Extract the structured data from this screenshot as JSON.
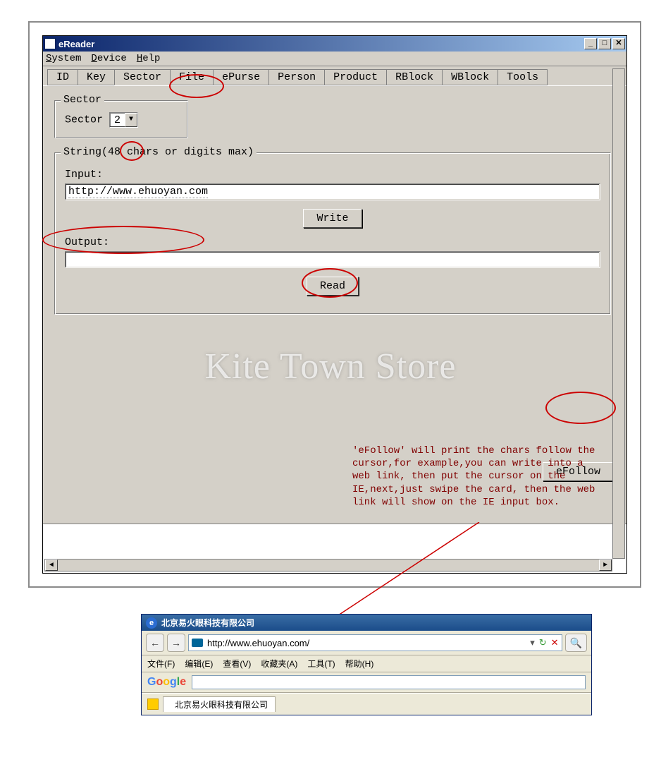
{
  "watermark": "Kite Town Store",
  "window": {
    "title": "eReader",
    "menus": {
      "system": "System",
      "device": "Device",
      "help": "Help"
    },
    "tabs": [
      "ID",
      "Key",
      "Sector",
      "File",
      "ePurse",
      "Person",
      "Product",
      "RBlock",
      "WBlock",
      "Tools"
    ],
    "active_tab_index": 2
  },
  "sector": {
    "legend": "Sector",
    "label": "Sector",
    "value": "2"
  },
  "string_group": {
    "legend": "String(48 chars or digits max)",
    "input_label": "Input:",
    "input_value": "http://www.ehuoyan.com",
    "write_btn": "Write",
    "output_label": "Output:",
    "output_value": "",
    "read_btn": "Read",
    "efollow_btn": "eFollow"
  },
  "annotation": {
    "text": "'eFollow' will print the chars follow the cursor,for example,you can write into a web link, then put the cursor on the IE,next,just swipe the card, then the web link will show on the IE input box."
  },
  "ie": {
    "title": "北京易火眼科技有限公司",
    "address": "http://www.ehuoyan.com/",
    "menus": [
      "文件(F)",
      "编辑(E)",
      "查看(V)",
      "收藏夹(A)",
      "工具(T)",
      "帮助(H)"
    ],
    "google": "Google",
    "tab_label": "北京易火眼科技有限公司"
  }
}
